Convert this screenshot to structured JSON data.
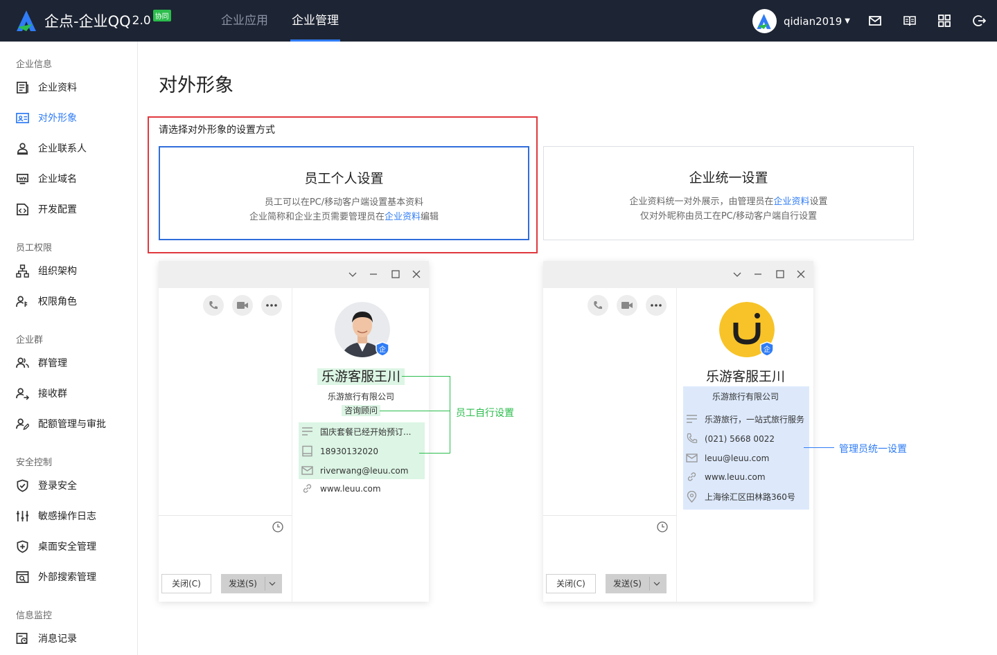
{
  "header": {
    "logo_text": "企点-企业QQ",
    "logo_version": "2.0",
    "logo_badge": "协同",
    "tabs": [
      {
        "label": "企业应用",
        "active": false
      },
      {
        "label": "企业管理",
        "active": true
      }
    ],
    "username": "qidian2019",
    "icons": [
      "mail-icon",
      "book-icon",
      "grid-icon",
      "logout-icon"
    ]
  },
  "sidebar": {
    "sections": [
      {
        "title": "企业信息",
        "items": [
          {
            "label": "企业资料",
            "icon": "document-icon"
          },
          {
            "label": "对外形象",
            "icon": "id-card-icon",
            "active": true
          },
          {
            "label": "企业联系人",
            "icon": "contact-icon"
          },
          {
            "label": "企业域名",
            "icon": "domain-icon"
          },
          {
            "label": "开发配置",
            "icon": "code-icon"
          }
        ]
      },
      {
        "title": "员工权限",
        "items": [
          {
            "label": "组织架构",
            "icon": "org-chart-icon"
          },
          {
            "label": "权限角色",
            "icon": "role-icon"
          }
        ]
      },
      {
        "title": "企业群",
        "items": [
          {
            "label": "群管理",
            "icon": "group-icon"
          },
          {
            "label": "接收群",
            "icon": "receive-group-icon"
          },
          {
            "label": "配额管理与审批",
            "icon": "quota-icon"
          }
        ]
      },
      {
        "title": "安全控制",
        "items": [
          {
            "label": "登录安全",
            "icon": "shield-check-icon"
          },
          {
            "label": "敏感操作日志",
            "icon": "sliders-icon"
          },
          {
            "label": "桌面安全管理",
            "icon": "shield-plus-icon"
          },
          {
            "label": "外部搜索管理",
            "icon": "search-window-icon"
          }
        ]
      },
      {
        "title": "信息监控",
        "items": [
          {
            "label": "消息记录",
            "icon": "message-record-icon"
          }
        ]
      }
    ]
  },
  "main": {
    "title": "对外形象",
    "prompt": "请选择对外形象的设置方式",
    "cards": [
      {
        "title": "员工个人设置",
        "line1": "员工可以在PC/移动客户端设置基本资料",
        "line2_pre": "企业简称和企业主页需要管理员在",
        "line2_link": "企业资料",
        "line2_post": "编辑",
        "selected": true
      },
      {
        "title": "企业统一设置",
        "line1_pre": "企业资料统一对外展示，由管理员在",
        "line1_link": "企业资料",
        "line1_post": "设置",
        "line2": "仅对外昵称由员工在PC/移动客户端自行设置",
        "selected": false
      }
    ]
  },
  "preview_left": {
    "name": "乐游客服王川",
    "company": "乐游旅行有限公司",
    "role": "咨询顾问",
    "rows": [
      {
        "text": "国庆套餐已经开始预订...",
        "icon": "signature-icon"
      },
      {
        "text": "18930132020",
        "icon": "mobile-icon"
      },
      {
        "text": "riverwang@leuu.com",
        "icon": "email-icon"
      },
      {
        "text": "www.leuu.com",
        "icon": "link-icon"
      }
    ],
    "close_label": "关闭(C)",
    "send_label": "发送(S)",
    "annotation": "员工自行设置"
  },
  "preview_right": {
    "name": "乐游客服王川",
    "company": "乐游旅行有限公司",
    "rows": [
      {
        "text": "乐游旅行，一站式旅行服务",
        "icon": "signature-icon"
      },
      {
        "text": "(021) 5668 0022",
        "icon": "phone-icon"
      },
      {
        "text": "leuu@leuu.com",
        "icon": "email-icon"
      },
      {
        "text": "www.leuu.com",
        "icon": "link-icon"
      },
      {
        "text": "上海徐汇区田林路360号",
        "icon": "location-icon"
      }
    ],
    "close_label": "关闭(C)",
    "send_label": "发送(S)",
    "annotation": "管理员统一设置",
    "logo_letter": "U"
  },
  "colors": {
    "topbar": "#1d2433",
    "accent": "#2f7cf6",
    "red_frame": "#e0383e",
    "green_highlight": "#dcf5e4",
    "blue_highlight": "#dde9fb",
    "green_annotation": "#2bbd4c",
    "blue_annotation": "#2f7cf6"
  }
}
